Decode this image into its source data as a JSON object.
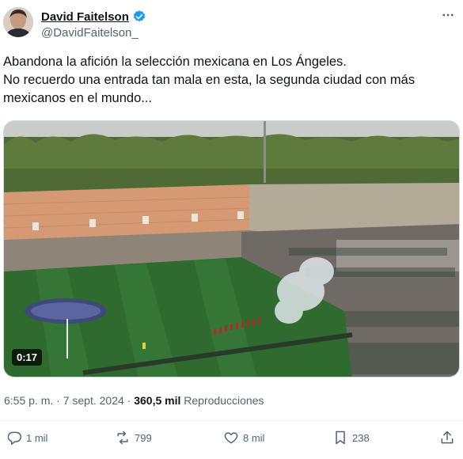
{
  "author": {
    "name": "David Faitelson",
    "handle": "@DavidFaitelson_",
    "verified": true
  },
  "tweet": {
    "lines": [
      "Abandona la afición la selección mexicana en Los Ángeles.",
      "No recuerdo una entrada tan mala en esta, la segunda ciudad con más",
      "mexicanos en el mundo..."
    ]
  },
  "media": {
    "duration": "0:17"
  },
  "meta": {
    "time": "6:55 p. m.",
    "separator": "·",
    "date": "7 sept. 2024",
    "views_count": "360,5 mil",
    "views_label": "Reproducciones"
  },
  "actions": {
    "replies": "1 mil",
    "reposts": "799",
    "likes": "8 mil",
    "bookmarks": "238"
  },
  "colors": {
    "accent": "#1d9bf0",
    "text": "#0f1419",
    "muted": "#536471"
  }
}
